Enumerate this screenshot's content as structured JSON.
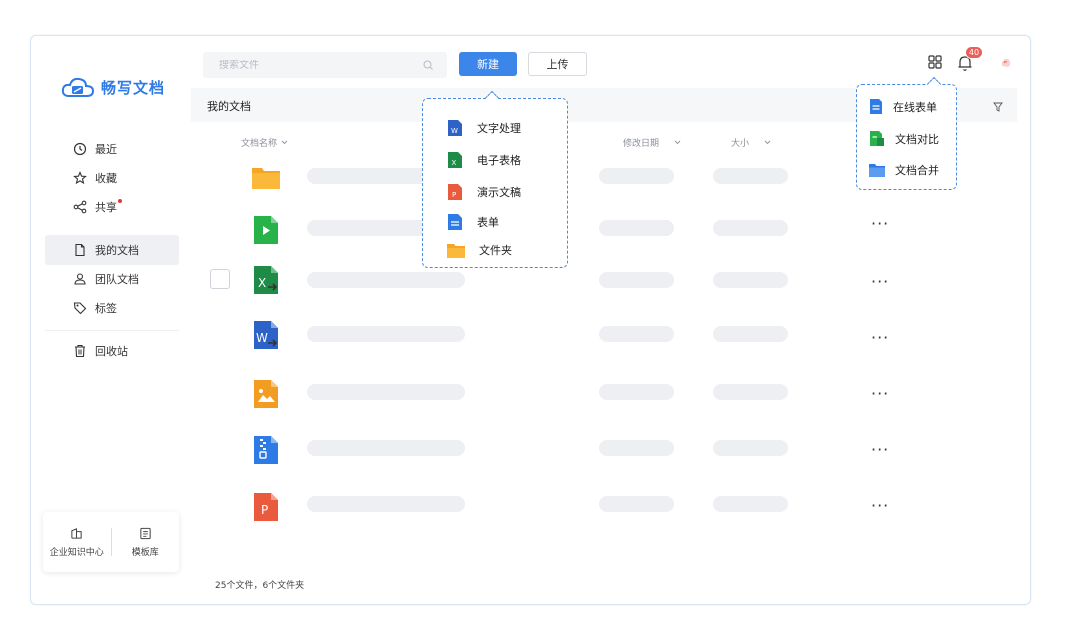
{
  "app": {
    "name": "畅写文档"
  },
  "sidebar": {
    "items": [
      {
        "label": "最近",
        "icon": "clock-icon"
      },
      {
        "label": "收藏",
        "icon": "star-icon"
      },
      {
        "label": "共享",
        "icon": "share-icon",
        "has_dot": true
      },
      {
        "label": "我的文档",
        "icon": "file-icon",
        "active": true
      },
      {
        "label": "团队文档",
        "icon": "team-icon"
      },
      {
        "label": "标签",
        "icon": "tag-icon"
      },
      {
        "label": "回收站",
        "icon": "trash-icon"
      }
    ],
    "bottom": [
      {
        "label": "企业知识中心",
        "icon": "knowledge-icon"
      },
      {
        "label": "模板库",
        "icon": "template-icon"
      }
    ]
  },
  "topbar": {
    "search_placeholder": "搜索文件",
    "new_label": "新建",
    "upload_label": "上传",
    "notification_count": "40"
  },
  "main": {
    "title": "我的文档",
    "columns": {
      "name": "文档名称",
      "modified": "修改日期",
      "size": "大小"
    },
    "footer": "25个文件，6个文件夹",
    "rows": [
      {
        "type": "folder",
        "color": "#f7a623"
      },
      {
        "type": "video",
        "color": "#27b24a"
      },
      {
        "type": "spreadsheet-share",
        "color": "#1e8c46"
      },
      {
        "type": "word-share",
        "color": "#2d62c6"
      },
      {
        "type": "image",
        "color": "#f39c22"
      },
      {
        "type": "zip",
        "color": "#2e7be6"
      },
      {
        "type": "ppt",
        "color": "#ea5b3e"
      }
    ]
  },
  "new_menu": {
    "items": [
      {
        "label": "文字处理",
        "icon": "word-icon",
        "color": "#2d62c6",
        "letter": "W"
      },
      {
        "label": "电子表格",
        "icon": "excel-icon",
        "color": "#1e8c46",
        "letter": "X"
      },
      {
        "label": "演示文稿",
        "icon": "ppt-icon",
        "color": "#ea5b3e",
        "letter": "P"
      },
      {
        "label": "表单",
        "icon": "form-icon",
        "color": "#2e7be6",
        "letter": ""
      },
      {
        "label": "文件夹",
        "icon": "folder-icon",
        "color": "#f7a623",
        "letter": ""
      }
    ]
  },
  "apps_menu": {
    "items": [
      {
        "label": "在线表单",
        "icon": "online-form-icon",
        "color": "#2e7be6"
      },
      {
        "label": "文档对比",
        "icon": "compare-icon",
        "color": "#27b24a"
      },
      {
        "label": "文档合并",
        "icon": "merge-icon",
        "color": "#2e7be6"
      }
    ]
  }
}
